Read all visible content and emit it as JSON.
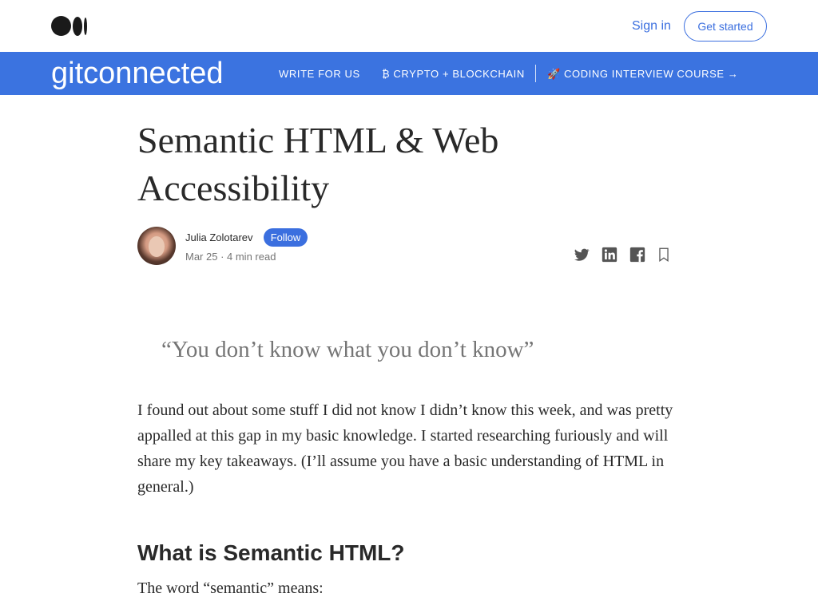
{
  "header": {
    "logo_icon": "medium-logo-icon",
    "signin_label": "Sign in",
    "getstarted_label": "Get started"
  },
  "publication": {
    "logo_text": "gitconnected",
    "nav": [
      {
        "label": "WRITE FOR US"
      },
      {
        "label": "₿ CRYPTO + BLOCKCHAIN"
      },
      {
        "label": "🚀 CODING INTERVIEW COURSE →"
      }
    ],
    "bg_color": "#3b73e0"
  },
  "article": {
    "title": "Semantic HTML & Web Accessibility",
    "author": "Julia Zolotarev",
    "follow_label": "Follow",
    "meta": "Mar 25 · 4 min read",
    "share_icons": [
      "twitter-icon",
      "linkedin-icon",
      "facebook-icon",
      "bookmark-icon"
    ],
    "pullquote": "“You don’t know what you don’t know”",
    "paragraph1": "I found out about some stuff I did not know I didn’t know this week, and was pretty appalled at this gap in my basic knowledge. I started researching furiously and will share my key takeaways. (I’ll assume you have a basic understanding of HTML in general.)",
    "heading1": "What is Semantic HTML?",
    "paragraph2": "The word “semantic” means:"
  },
  "colors": {
    "accent": "#3b6fdf",
    "text": "#292929",
    "muted": "#757575"
  }
}
